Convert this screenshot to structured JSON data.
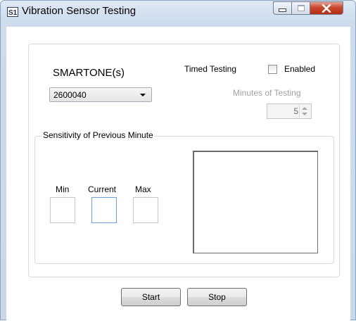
{
  "window": {
    "title": "Vibration Sensor Testing",
    "icon": "s1-app-icon"
  },
  "smartone": {
    "label": "SMARTONE(s)",
    "selected": "2600040"
  },
  "timed_testing": {
    "label": "Timed Testing",
    "enabled_label": "Enabled",
    "enabled_checked": false,
    "minutes_label": "Minutes of Testing",
    "minutes_value": "5"
  },
  "sensitivity": {
    "group_title": "Sensitivity of Previous Minute",
    "min_label": "Min",
    "current_label": "Current",
    "max_label": "Max",
    "min_value": "",
    "current_value": "",
    "max_value": ""
  },
  "buttons": {
    "start": "Start",
    "stop": "Stop"
  },
  "colors": {
    "titlebar": "#cddbed",
    "close_button": "#c9462c",
    "disabled_text": "#a0a0a0"
  }
}
